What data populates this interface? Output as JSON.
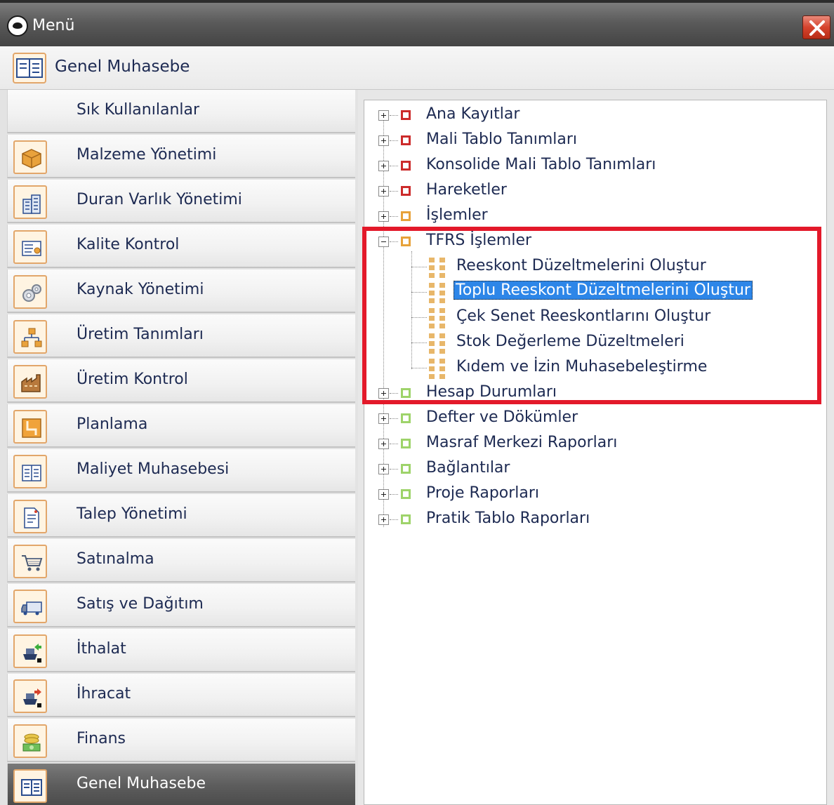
{
  "window": {
    "title": "Menü",
    "close_icon": "close-icon"
  },
  "module_header": {
    "label": "Genel Muhasebe",
    "icon": "ledger-icon"
  },
  "sidebar": {
    "items": [
      {
        "label": "Sık Kullanılanlar",
        "icon": ""
      },
      {
        "label": "Malzeme Yönetimi",
        "icon": "box-icon"
      },
      {
        "label": "Duran Varlık Yönetimi",
        "icon": "building-icon"
      },
      {
        "label": "Kalite Kontrol",
        "icon": "quality-icon"
      },
      {
        "label": "Kaynak Yönetimi",
        "icon": "gears-icon"
      },
      {
        "label": "Üretim Tanımları",
        "icon": "flowchart-icon"
      },
      {
        "label": "Üretim Kontrol",
        "icon": "factory-icon"
      },
      {
        "label": "Planlama",
        "icon": "plan-icon"
      },
      {
        "label": "Maliyet Muhasebesi",
        "icon": "cost-icon"
      },
      {
        "label": "Talep Yönetimi",
        "icon": "document-icon"
      },
      {
        "label": "Satınalma",
        "icon": "cart-icon"
      },
      {
        "label": "Satış ve Dağıtım",
        "icon": "truck-icon"
      },
      {
        "label": "İthalat",
        "icon": "ship-import-icon"
      },
      {
        "label": "İhracat",
        "icon": "ship-export-icon"
      },
      {
        "label": "Finans",
        "icon": "money-icon"
      },
      {
        "label": "Genel Muhasebe",
        "icon": "ledger-icon",
        "active": true
      }
    ]
  },
  "tree": {
    "items": [
      {
        "label": "Ana Kayıtlar",
        "expander": "plus",
        "folder_color": "#cc2b2b"
      },
      {
        "label": "Mali Tablo Tanımları",
        "expander": "plus",
        "folder_color": "#cc2b2b"
      },
      {
        "label": "Konsolide Mali Tablo Tanımları",
        "expander": "plus",
        "folder_color": "#cc2b2b"
      },
      {
        "label": "Hareketler",
        "expander": "plus",
        "folder_color": "#cc2b2b"
      },
      {
        "label": "İşlemler",
        "expander": "plus",
        "folder_color": "#e7a23a"
      },
      {
        "label": "TFRS İşlemler",
        "expander": "minus",
        "folder_color": "#e7a23a",
        "children": [
          {
            "label": "Reeskont Düzeltmelerini Oluştur"
          },
          {
            "label": "Toplu Reeskont Düzeltmelerini Oluştur",
            "selected": true
          },
          {
            "label": "Çek Senet Reeskontlarını Oluştur"
          },
          {
            "label": "Stok Değerleme Düzeltmeleri"
          },
          {
            "label": "Kıdem ve İzin Muhasebeleştirme"
          }
        ]
      },
      {
        "label": "Hesap Durumları",
        "expander": "plus",
        "folder_color": "#9ed36a"
      },
      {
        "label": "Defter ve Dökümler",
        "expander": "plus",
        "folder_color": "#9ed36a"
      },
      {
        "label": "Masraf Merkezi Raporları",
        "expander": "plus",
        "folder_color": "#9ed36a"
      },
      {
        "label": "Bağlantılar",
        "expander": "plus",
        "folder_color": "#9ed36a"
      },
      {
        "label": "Proje Raporları",
        "expander": "plus",
        "folder_color": "#9ed36a"
      },
      {
        "label": "Pratik Tablo Raporları",
        "expander": "plus",
        "folder_color": "#9ed36a"
      }
    ]
  },
  "colors": {
    "highlight_box": "#e3192a",
    "selection": "#2d86e8",
    "text": "#1d2a52"
  }
}
